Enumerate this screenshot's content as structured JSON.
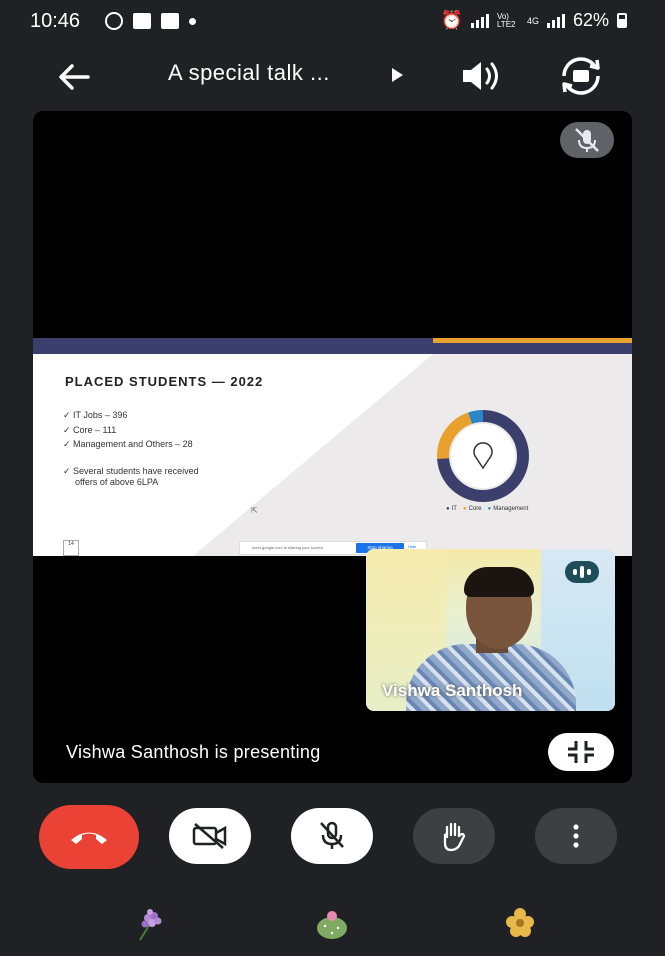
{
  "status_bar": {
    "time": "10:46",
    "network_label": "Vo) LTE2",
    "network_type": "4G",
    "battery": "62%"
  },
  "top_bar": {
    "title": "A special talk ...",
    "icons": [
      "back-arrow-icon",
      "play-icon",
      "speaker-icon",
      "flip-camera-icon"
    ]
  },
  "slide": {
    "title": "PLACED STUDENTS — 2022",
    "items": [
      "IT Jobs – 396",
      "Core – 111",
      "Management and Others – 28"
    ],
    "note_line1": "Several students have received",
    "note_line2": "offers of above 6LPA",
    "legend": [
      "IT",
      "Core",
      "Management"
    ],
    "donut_values": {
      "IT": 396,
      "Core": 111,
      "Management": 28
    },
    "page_number": "14",
    "share_text": "meet.google.com is sharing your screen.",
    "stop_label": "Stop sharing",
    "hide_label": "Hide",
    "colors": {
      "IT": "#3b3f6b",
      "Core": "#e7a12c",
      "Management": "#2a86c8"
    }
  },
  "participant": {
    "name": "Vishwa Santhosh"
  },
  "presenting_text": "Vishwa Santhosh is presenting",
  "controls": {
    "end_call": "end-call-icon",
    "camera": "camera-off-icon",
    "mic": "mic-off-icon",
    "hand": "raise-hand-icon",
    "more": "more-options-icon"
  },
  "reactions": [
    "lilac-flower-icon",
    "cactus-icon",
    "yellow-flower-icon"
  ]
}
